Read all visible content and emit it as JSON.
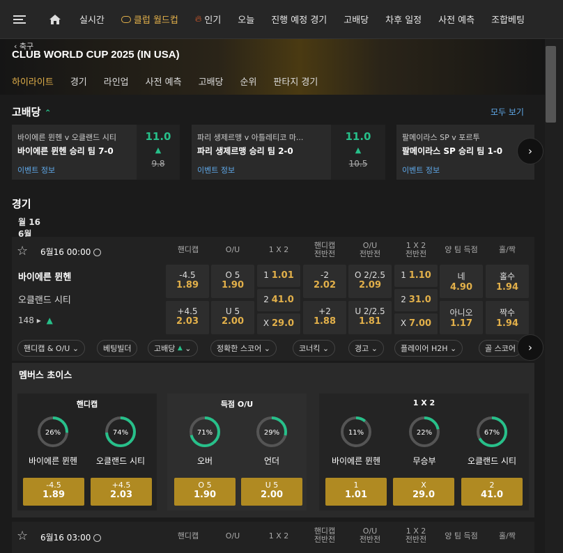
{
  "nav": {
    "items": [
      {
        "label": "실시간",
        "gold": false
      },
      {
        "label": "클럽 월드컵",
        "gold": true
      },
      {
        "label": "인기",
        "gold": false
      },
      {
        "label": "오늘",
        "gold": false
      },
      {
        "label": "진행 예정 경기",
        "gold": false
      },
      {
        "label": "고배당",
        "gold": false
      },
      {
        "label": "차후 일정",
        "gold": false
      },
      {
        "label": "사전 예측",
        "gold": false
      },
      {
        "label": "조합베팅",
        "gold": false
      }
    ]
  },
  "hero": {
    "back": "축구",
    "title": "CLUB WORLD CUP 2025 (IN USA)",
    "tabs": [
      "하이라이트",
      "경기",
      "라인업",
      "사전 예측",
      "고배당",
      "순위",
      "판타지 경기"
    ],
    "active_tab": "하이라이트"
  },
  "highodds": {
    "title": "고배당",
    "all": "모두 보기",
    "info": "이벤트 정보",
    "cards": [
      {
        "match": "바이에른 뮌헨 v 오클랜드 시티",
        "sel": "바이에른 뮌헨 승리 팀 7-0",
        "odd": "11.0",
        "old": "9.8"
      },
      {
        "match": "파리 생제르맹 v 아틀레티코 마...",
        "sel": "파리 생제르맹 승리 팀 2-0",
        "odd": "11.0",
        "old": "10.5"
      },
      {
        "match": "팔메이라스 SP v 포르투",
        "sel": "팔메이라스 SP 승리 팀 1-0",
        "odd": "",
        "old": ""
      }
    ]
  },
  "games": {
    "title": "경기",
    "date": "월 16 6월",
    "headers": [
      "핸디캡",
      "O/U",
      "1 X 2",
      "핸디캡\n전반전",
      "O/U\n전반전",
      "1 X 2\n전반전",
      "양 팀 득점",
      "홀/짝"
    ],
    "match1": {
      "time": "6월16 00:00",
      "home": "바이에른 뮌헨",
      "away": "오클랜드 시티",
      "count": "148",
      "odds": [
        [
          {
            "a": "-4.5",
            "v": "1.89"
          },
          {
            "a": "O 5",
            "v": "1.90"
          },
          {
            "a": "1",
            "v": "1.01"
          },
          {
            "a": "-2",
            "v": "2.02"
          },
          {
            "a": "O 2/2.5",
            "v": "2.09"
          },
          {
            "a": "1",
            "v": "1.10"
          },
          {
            "a": "네",
            "v": "4.90"
          },
          {
            "a": "홀수",
            "v": "1.94"
          }
        ],
        [
          {
            "a": "+4.5",
            "v": "2.03"
          },
          {
            "a": "U 5",
            "v": "2.00"
          },
          {
            "a": "2",
            "v": "41.0"
          },
          {
            "a": "+2",
            "v": "1.88"
          },
          {
            "a": "U 2/2.5",
            "v": "1.81"
          },
          {
            "a": "2",
            "v": "31.0"
          },
          {
            "a": "아니오",
            "v": "1.17"
          },
          {
            "a": "짝수",
            "v": "1.94"
          }
        ],
        [
          null,
          null,
          {
            "a": "X",
            "v": "29.0"
          },
          null,
          null,
          {
            "a": "X",
            "v": "7.00"
          },
          null,
          null
        ]
      ]
    },
    "filters": [
      "핸디캡 & O/U",
      "베팅빌더",
      "고배당",
      "정확한 스코어",
      "코너킥",
      "경고",
      "플레이어 H2H",
      "골 스코어"
    ],
    "match2": {
      "time": "6월16 03:00"
    }
  },
  "members": {
    "title": "멤버스 초이스",
    "panels": [
      {
        "title": "핸디캡",
        "items": [
          {
            "pct": 26,
            "name": "바이에른 뮌헨",
            "a": "-4.5",
            "v": "1.89"
          },
          {
            "pct": 74,
            "name": "오클랜드 시티",
            "a": "+4.5",
            "v": "2.03"
          }
        ]
      },
      {
        "title": "득점 O/U",
        "items": [
          {
            "pct": 71,
            "name": "오버",
            "a": "O 5",
            "v": "1.90"
          },
          {
            "pct": 29,
            "name": "언더",
            "a": "U 5",
            "v": "2.00"
          }
        ]
      },
      {
        "title": "1 X 2",
        "items": [
          {
            "pct": 11,
            "name": "바이에른 뮌헨",
            "a": "1",
            "v": "1.01"
          },
          {
            "pct": 22,
            "name": "무승부",
            "a": "X",
            "v": "29.0"
          },
          {
            "pct": 67,
            "name": "오클랜드 시티",
            "a": "2",
            "v": "41.0"
          }
        ]
      }
    ]
  },
  "colors": {
    "gold": "#e2b04a",
    "green": "#27c08a",
    "link": "#5fa8e8",
    "button": "#b08a22"
  }
}
